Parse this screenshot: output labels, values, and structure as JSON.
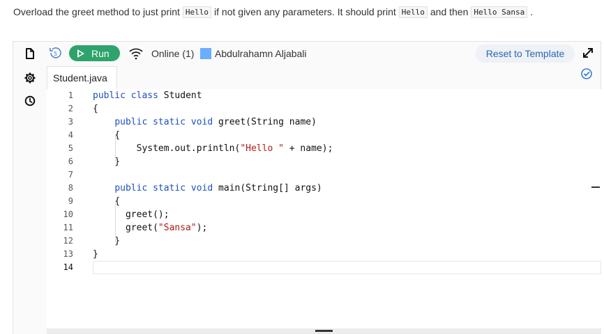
{
  "instructions": {
    "part1": "Overload the greet method to just print",
    "code1": "Hello",
    "part2": "if not given any parameters. It should print",
    "code2": "Hello",
    "part3": "and then",
    "code3": "Hello Sansa",
    "part4": "."
  },
  "toolbar": {
    "run_label": "Run",
    "online_status": "Online (1)",
    "user_name": "Abdulrahamn Aljabali",
    "reset_label": "Reset to Template"
  },
  "colors": {
    "run_button": "#2ea36b",
    "reset_button_text": "#2f66b3",
    "user_avatar": "#6aaeff",
    "keyword": "#1f4fbf",
    "string": "#b31b1b"
  },
  "icons": {
    "file": "file-icon",
    "settings": "gear-icon",
    "history": "clock-icon",
    "undo": "undo-icon",
    "wifi": "wifi-icon",
    "expand": "expand-icon",
    "check": "check-circle-icon"
  },
  "editor": {
    "file_tab": "Student.java",
    "line_numbers": [
      "1",
      "2",
      "3",
      "4",
      "5",
      "6",
      "7",
      "8",
      "9",
      "10",
      "11",
      "12",
      "13",
      "14"
    ],
    "lines": [
      "public class Student",
      "{",
      "    public static void greet(String name)",
      "    {",
      "        System.out.println(\"Hello \" + name);",
      "    }",
      "",
      "    public static void main(String[] args)",
      "    {",
      "      greet();",
      "      greet(\"Sansa\");",
      "    }",
      "}",
      ""
    ],
    "current_line": 14
  }
}
